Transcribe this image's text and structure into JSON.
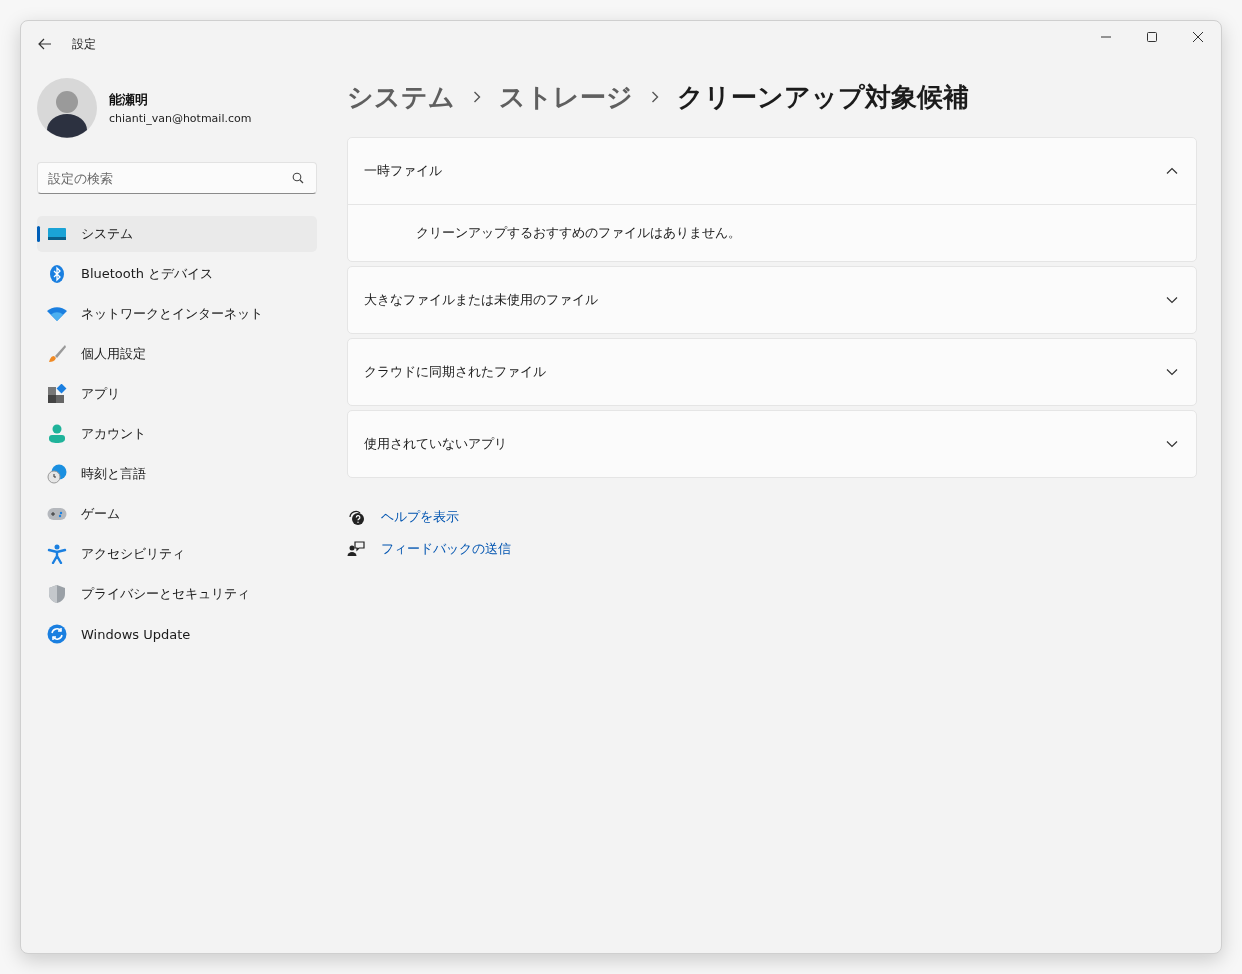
{
  "window": {
    "title": "設定"
  },
  "user": {
    "name": "能瀬明",
    "email": "chianti_van@hotmail.com"
  },
  "search": {
    "placeholder": "設定の検索"
  },
  "sidebar": {
    "items": [
      {
        "label": "システム",
        "selected": true
      },
      {
        "label": "Bluetooth とデバイス",
        "selected": false
      },
      {
        "label": "ネットワークとインターネット",
        "selected": false
      },
      {
        "label": "個人用設定",
        "selected": false
      },
      {
        "label": "アプリ",
        "selected": false
      },
      {
        "label": "アカウント",
        "selected": false
      },
      {
        "label": "時刻と言語",
        "selected": false
      },
      {
        "label": "ゲーム",
        "selected": false
      },
      {
        "label": "アクセシビリティ",
        "selected": false
      },
      {
        "label": "プライバシーとセキュリティ",
        "selected": false
      },
      {
        "label": "Windows Update",
        "selected": false
      }
    ]
  },
  "breadcrumb": [
    "システム",
    "ストレージ",
    "クリーンアップ対象候補"
  ],
  "sections": [
    {
      "title": "一時ファイル",
      "expanded": true,
      "message": "クリーンアップするおすすめのファイルはありません。"
    },
    {
      "title": "大きなファイルまたは未使用のファイル",
      "expanded": false
    },
    {
      "title": "クラウドに同期されたファイル",
      "expanded": false
    },
    {
      "title": "使用されていないアプリ",
      "expanded": false
    }
  ],
  "links": [
    "ヘルプを表示",
    "フィードバックの送信"
  ]
}
